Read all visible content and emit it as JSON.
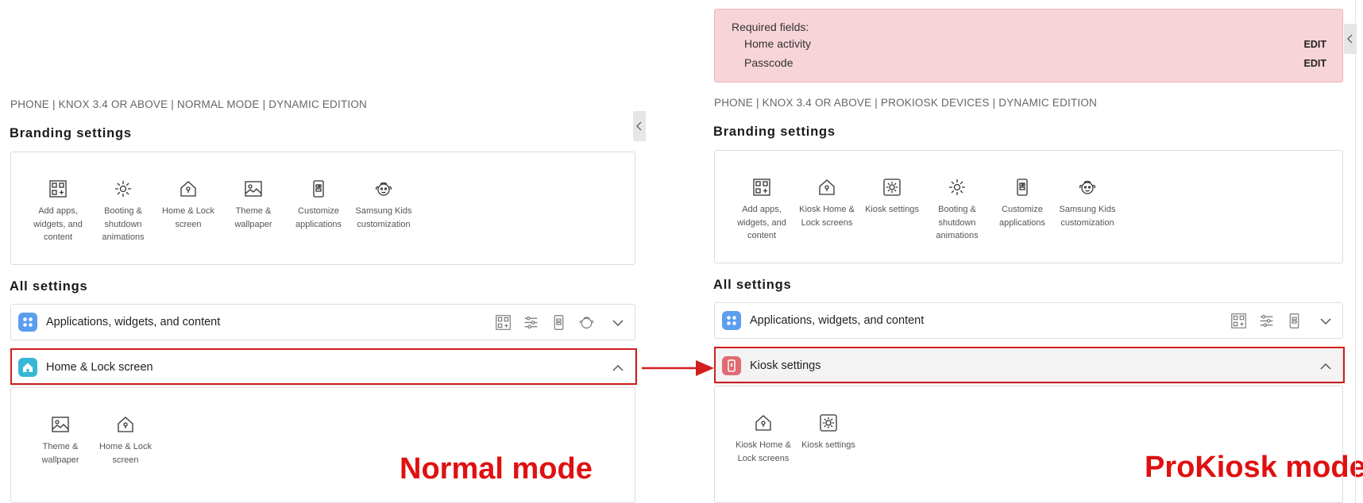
{
  "left": {
    "breadcrumb": "PHONE | KNOX 3.4 OR ABOVE | NORMAL MODE | DYNAMIC EDITION",
    "branding_title": "Branding settings",
    "branding_tiles": [
      {
        "icon": "add-apps-icon",
        "label": "Add apps, widgets, and content"
      },
      {
        "icon": "booting-icon",
        "label": "Booting & shutdown animations"
      },
      {
        "icon": "home-lock-icon",
        "label": "Home & Lock screen"
      },
      {
        "icon": "wallpaper-icon",
        "label": "Theme & wallpaper"
      },
      {
        "icon": "customize-apps-icon",
        "label": "Customize applications"
      },
      {
        "icon": "samsung-kids-icon",
        "label": "Samsung Kids customization"
      }
    ],
    "all_settings_title": "All settings",
    "row1_label": "Applications, widgets, and content",
    "row2_label": "Home & Lock screen",
    "expanded_tiles": [
      {
        "icon": "wallpaper-icon",
        "label": "Theme & wallpaper"
      },
      {
        "icon": "home-lock-icon",
        "label": "Home & Lock screen"
      }
    ],
    "caption": "Normal mode"
  },
  "right": {
    "required": {
      "title": "Required fields:",
      "items": [
        {
          "label": "Home activity",
          "action": "EDIT"
        },
        {
          "label": "Passcode",
          "action": "EDIT"
        }
      ]
    },
    "breadcrumb": "PHONE | KNOX 3.4 OR ABOVE | PROKIOSK DEVICES | DYNAMIC EDITION",
    "branding_title": "Branding settings",
    "branding_tiles": [
      {
        "icon": "add-apps-icon",
        "label": "Add apps, widgets, and content"
      },
      {
        "icon": "kiosk-home-icon",
        "label": "Kiosk Home & Lock screens"
      },
      {
        "icon": "kiosk-settings-icon",
        "label": "Kiosk settings"
      },
      {
        "icon": "booting-icon",
        "label": "Booting & shutdown animations"
      },
      {
        "icon": "customize-apps-icon",
        "label": "Customize applications"
      },
      {
        "icon": "samsung-kids-icon",
        "label": "Samsung Kids customization"
      }
    ],
    "all_settings_title": "All settings",
    "row1_label": "Applications, widgets, and content",
    "row2_label": "Kiosk settings",
    "expanded_tiles": [
      {
        "icon": "kiosk-home-icon",
        "label": "Kiosk Home & Lock screens"
      },
      {
        "icon": "kiosk-settings-icon",
        "label": "Kiosk settings"
      }
    ],
    "caption": "ProKiosk mode"
  },
  "colors": {
    "highlight": "#d21e1e",
    "caption": "#e01010",
    "apps_badge": "#5b9ef0",
    "home_badge": "#37b7d6",
    "kiosk_badge": "#e06b73",
    "required_bg": "#f7d4d8"
  }
}
